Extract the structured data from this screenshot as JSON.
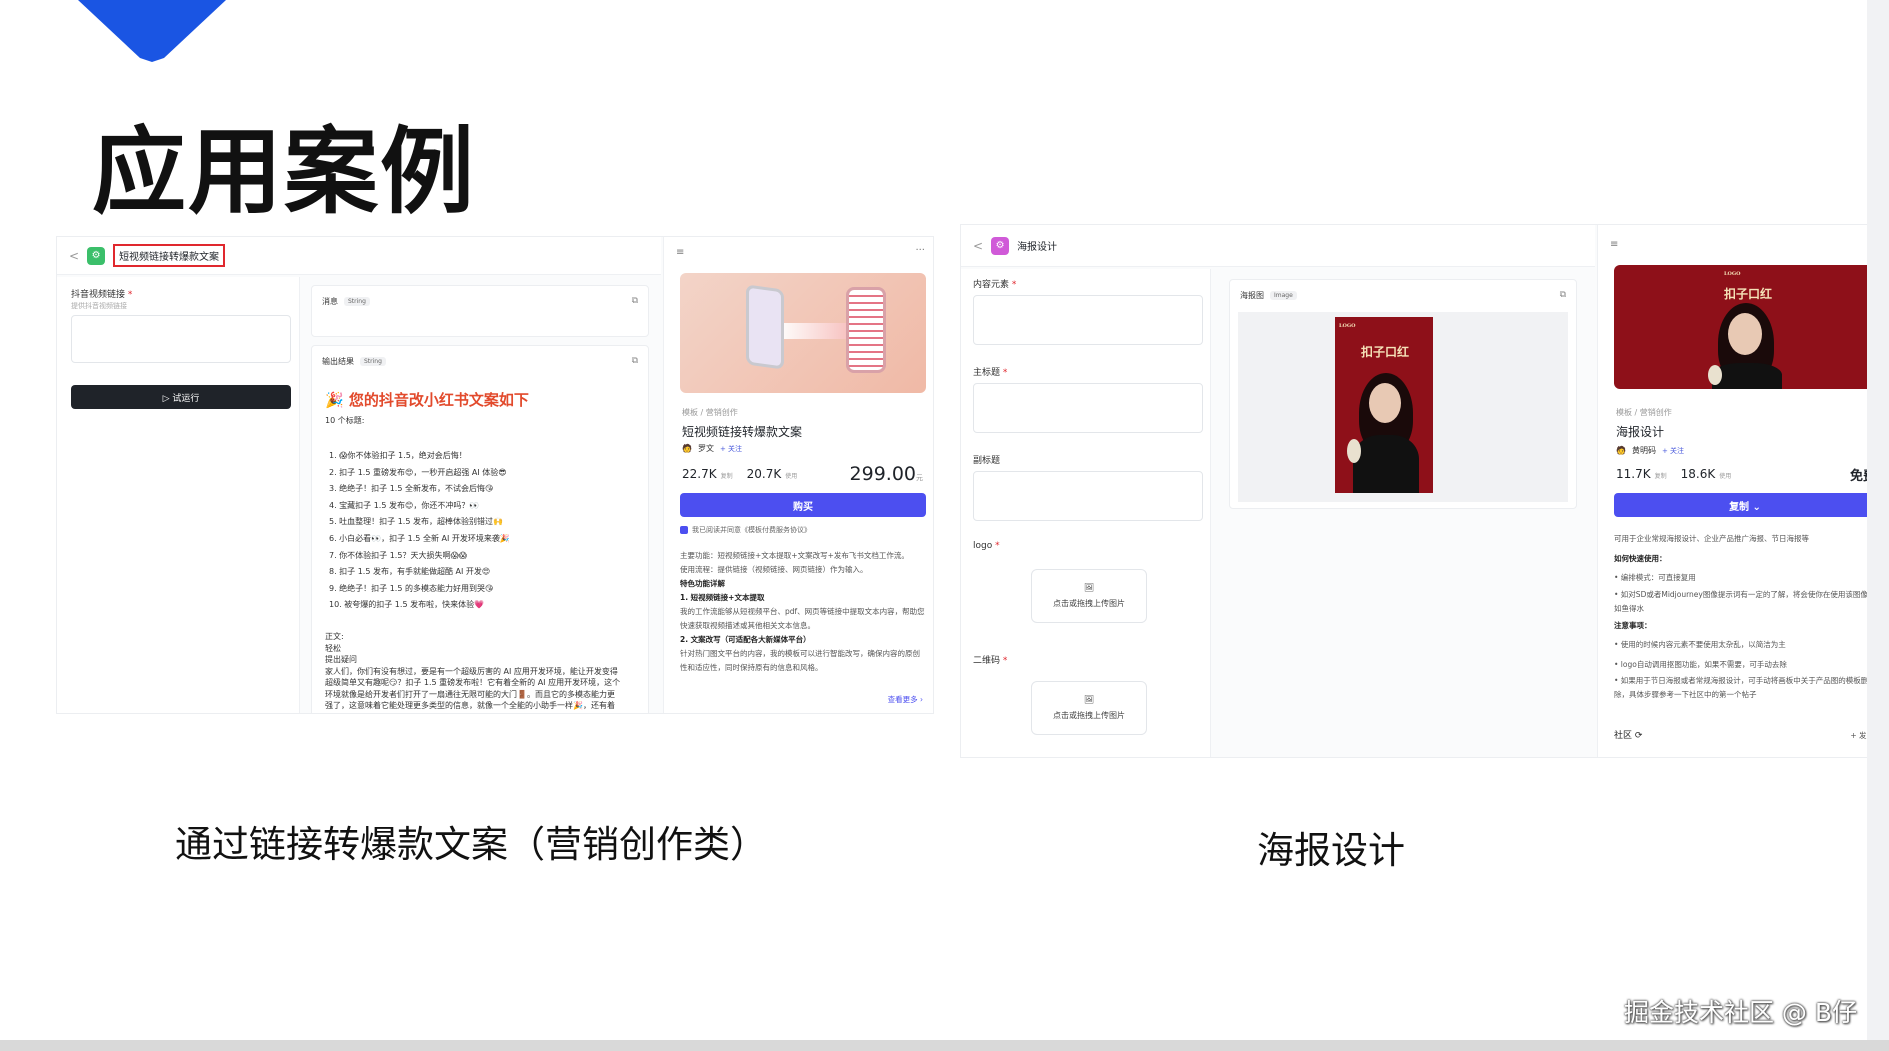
{
  "slide": {
    "title": "应用案例",
    "caption_left": "通过链接转爆款文案（营销创作类）",
    "caption_right": "海报设计",
    "watermark": "掘金技术社区 @ B仔",
    "accent": "#1a55e3"
  },
  "app1": {
    "back": "<",
    "name": "短视频链接转爆款文案",
    "input_label": "抖音视频链接",
    "input_required": "*",
    "input_hint": "提供抖音视频链接",
    "run_label": "▷ 试运行",
    "message_label": "消息",
    "message_type": "String",
    "output_label": "输出结果",
    "output_type": "String",
    "result_title": "您的抖音改小红书文案如下",
    "titles_header": "10 个标题:",
    "titles": [
      "1. 😱你不体验扣子 1.5，绝对会后悔！",
      "2. 扣子 1.5 重磅发布😍，一秒开启超强 AI 体验😎",
      "3. 绝绝子！扣子 1.5 全新发布，不试会后悔😘",
      "4. 宝藏扣子 1.5 发布😊，你还不冲吗？👀",
      "5. 吐血整理！扣子 1.5 发布，超棒体验别错过🙌",
      "6. 小白必看👀，扣子 1.5 全新 AI 开发环境来袭🎉",
      "7. 你不体验扣子 1.5？天大损失啊😱😱",
      "8. 扣子 1.5 发布，有手就能做超酷 AI 开发😍",
      "9. 绝绝子！扣子 1.5 的多模态能力好用到哭😘",
      "10. 被夸爆的扣子 1.5 发布啦，快来体验💗"
    ],
    "body_header": "正文:",
    "body_lines": [
      "轻松",
      "提出疑问",
      "家人们，你们有没有想过，要是有一个超级厉害的 AI 应用开发环境，能让开发变得",
      "超级简单又有趣呢😏？扣子 1.5 重磅发布啦！它有着全新的 AI 应用开发环境，这个",
      "环境就像是给开发者们打开了一扇通往无限可能的大门🚪。而且它的多模态能力更",
      "强了，这意味着它能处理更多类型的信息，就像一个全能的小助手一样🎉，还有着"
    ],
    "market": {
      "crumb": "模板 / 营销创作",
      "name": "短视频链接转爆款文案",
      "author": "罗文",
      "follow": "+ 关注",
      "copies": "22.7K",
      "copies_unit": "复制",
      "uses": "20.7K",
      "uses_unit": "使用",
      "price": "299.00",
      "price_unit": "元",
      "buy": "购买",
      "agree": "我已阅读并同意《模板付费服务协议》",
      "desc1": "主要功能：短视频链接+文本提取+文案改写+发布飞书文档工作流。",
      "desc2": "使用流程：提供链接（视频链接、网页链接）作为输入。",
      "feature_title": "特色功能详解",
      "feature1": "1.  短视频链接+文本提取",
      "feature1_text": "我的工作流能够从短视频平台、pdf、网页等链接中提取文本内容，帮助您快速获取视频描述或其他相关文本信息。",
      "feature2": "2.  文案改写（可适配各大新媒体平台）",
      "feature2_text": "针对热门图文平台的内容，我的模板可以进行智能改写，确保内容的原创性和适应性，同时保持原有的信息和风格。",
      "more": "查看更多 ›"
    }
  },
  "app2": {
    "back": "<",
    "name": "海报设计",
    "fields": [
      {
        "label": "内容元素",
        "required": "*"
      },
      {
        "label": "主标题",
        "required": "*"
      },
      {
        "label": "副标题",
        "required": ""
      },
      {
        "label": "logo",
        "required": "*"
      },
      {
        "label": "二维码",
        "required": "*"
      }
    ],
    "upload_hint": "点击或拖拽上传图片",
    "output_label": "海报图",
    "output_type": "Image",
    "poster_text": "扣子口红",
    "poster_logo": "LOGO",
    "market": {
      "crumb": "模板 / 营销创作",
      "name": "海报设计",
      "author": "黄明码",
      "follow": "+ 关注",
      "copies": "11.7K",
      "copies_unit": "复制",
      "uses": "18.6K",
      "uses_unit": "使用",
      "price": "免费",
      "copy": "复制 ⌄",
      "desc": "可用于企业常规海报设计、企业产品推广海报、节日海报等",
      "quick_title": "如何快速使用：",
      "quick1": "• 编排模式：可直接复用",
      "quick2": "• 如对SD或者Midjourney图像提示词有一定的了解，将会使你在使用该图像流如鱼得水",
      "note_title": "注意事项：",
      "note1": "• 使用的时候内容元素不要使用太杂乱，以简洁为主",
      "note2": "• logo自动调用抠图功能，如果不需要，可手动去除",
      "note3": "• 如果用于节日海报或者常规海报设计，可手动将画板中关于产品图的模板删除，具体步骤参考一下社区中的第一个帖子",
      "community": "社区 ⟳",
      "post": "+ 发帖"
    }
  }
}
